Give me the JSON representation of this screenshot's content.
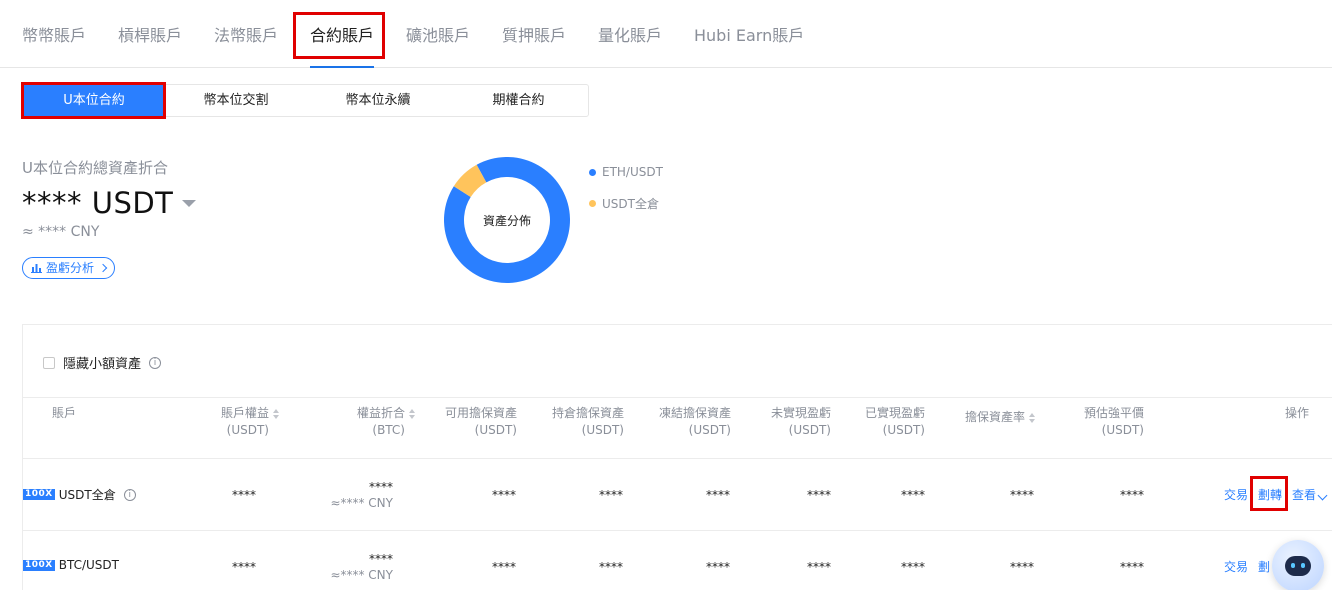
{
  "top_tabs": [
    {
      "label": "幣幣賬戶"
    },
    {
      "label": "槓桿賬戶"
    },
    {
      "label": "法幣賬戶"
    },
    {
      "label": "合約賬戶",
      "active": true
    },
    {
      "label": "礦池賬戶"
    },
    {
      "label": "質押賬戶"
    },
    {
      "label": "量化賬戶"
    },
    {
      "label": "Hubi Earn賬戶"
    }
  ],
  "sub_tabs": [
    {
      "label": "U本位合約",
      "active": true
    },
    {
      "label": "幣本位交割"
    },
    {
      "label": "幣本位永續"
    },
    {
      "label": "期權合約"
    }
  ],
  "summary": {
    "title": "U本位合約總資產折合",
    "value": "**** USDT",
    "cny": "≈ **** CNY",
    "pnl_button": "盈虧分析"
  },
  "distribution": {
    "center_label": "資產分佈",
    "legend": [
      {
        "name": "ETH/USDT",
        "color": "#2a7fff"
      },
      {
        "name": "USDT全倉",
        "color": "#ffc45c"
      }
    ],
    "shares": [
      0.92,
      0.08
    ]
  },
  "table": {
    "hide_small_label": "隱藏小額資產",
    "headers": [
      {
        "line1": "賬戶",
        "line2": ""
      },
      {
        "line1": "賬戶權益",
        "line2": "(USDT)"
      },
      {
        "line1": "權益折合",
        "line2": "(BTC)"
      },
      {
        "line1": "可用擔保資產",
        "line2": "(USDT)"
      },
      {
        "line1": "持倉擔保資產",
        "line2": "(USDT)"
      },
      {
        "line1": "凍結擔保資產",
        "line2": "(USDT)"
      },
      {
        "line1": "未實現盈虧",
        "line2": "(USDT)"
      },
      {
        "line1": "已實現盈虧",
        "line2": "(USDT)"
      },
      {
        "line1": "擔保資產率",
        "line2": ""
      },
      {
        "line1": "預估強平價",
        "line2": "(USDT)"
      },
      {
        "line1": "操作",
        "line2": ""
      }
    ],
    "rows": [
      {
        "leverage": "100X",
        "account": "USDT全倉",
        "equity": "****",
        "equity_btc": "****",
        "equity_cny": "≈**** CNY",
        "available": "****",
        "position_margin": "****",
        "frozen": "****",
        "unrealized": "****",
        "realized": "****",
        "margin_rate": "****",
        "liq_price": "****",
        "op_trade": "交易",
        "op_transfer": "劃轉",
        "op_view": "查看"
      },
      {
        "leverage": "100X",
        "account": "BTC/USDT",
        "equity": "****",
        "equity_btc": "****",
        "equity_cny": "≈**** CNY",
        "available": "****",
        "position_margin": "****",
        "frozen": "****",
        "unrealized": "****",
        "realized": "****",
        "margin_rate": "****",
        "liq_price": "****",
        "op_trade": "交易",
        "op_transfer": "劃"
      }
    ]
  }
}
